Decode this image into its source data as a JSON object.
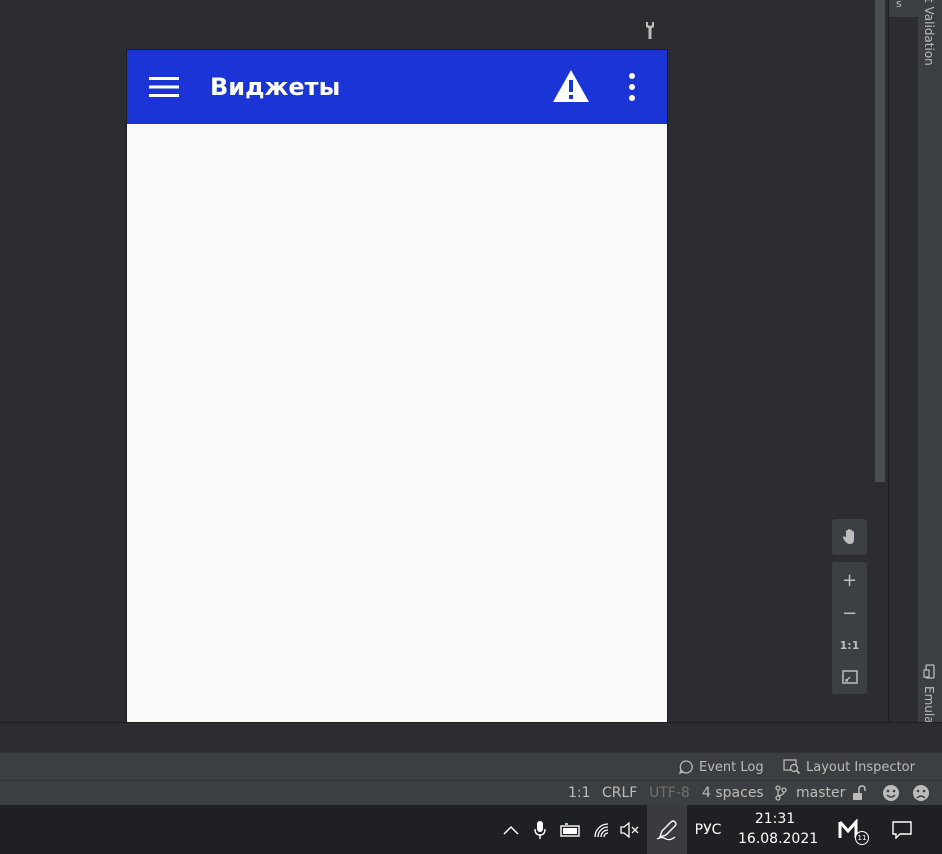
{
  "app": {
    "title": "Виджеты",
    "appbar_color": "#1a34d6",
    "icons": [
      "menu-icon",
      "warning-icon",
      "more-vertical-icon"
    ]
  },
  "side_panels": {
    "top_tab": "s",
    "validation_label": "t Validation",
    "emulator_label": "Emulator"
  },
  "zoom_controls": {
    "zoom_in": "+",
    "zoom_out": "−",
    "actual_size": "1:1"
  },
  "tool_windows": {
    "event_log": "Event Log",
    "layout_inspector": "Layout Inspector"
  },
  "status": {
    "position": "1:1",
    "line_sep": "CRLF",
    "encoding": "UTF-8",
    "indent": "4 spaces",
    "branch": "master"
  },
  "taskbar": {
    "language": "РУС",
    "time": "21:31",
    "date": "16.08.2021",
    "notification_count": "11"
  }
}
